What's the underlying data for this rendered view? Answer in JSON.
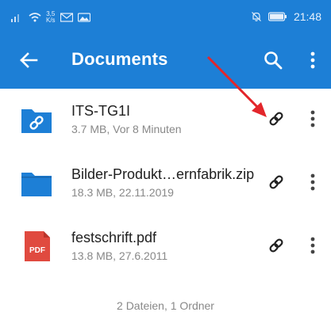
{
  "status_bar": {
    "net_speed_value": "3,5",
    "net_speed_unit": "K/s",
    "time": "21:48"
  },
  "app_bar": {
    "title": "Documents"
  },
  "files": [
    {
      "name": "ITS-TG1I",
      "meta": "3.7 MB, Vor 8 Minuten",
      "icon": "shared-folder-icon"
    },
    {
      "name": "Bilder-Produkt…ernfabrik.zip",
      "meta": "18.3 MB, 22.11.2019",
      "icon": "zip-folder-icon"
    },
    {
      "name": "festschrift.pdf",
      "meta": "13.8 MB, 27.6.2011",
      "icon": "pdf-icon"
    }
  ],
  "pdf_icon_text": "PDF",
  "footer_text": "2 Dateien, 1 Ordner",
  "colors": {
    "primary": "#1d7fd6",
    "folder": "#1d7fd6",
    "pdf": "#e04a3f",
    "annotation_arrow": "#e3262b"
  }
}
